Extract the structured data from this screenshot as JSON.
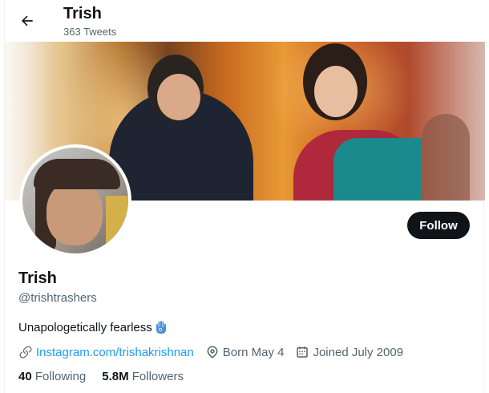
{
  "header": {
    "name": "Trish",
    "tweet_count": "363 Tweets"
  },
  "profile": {
    "name": "Trish",
    "handle": "@trishtrashers",
    "bio": "Unapologetically fearless",
    "follow_label": "Follow",
    "website": "Instagram.com/trishakrishnan",
    "born": "Born May 4",
    "joined": "Joined July 2009",
    "following_count": "40",
    "following_label": "Following",
    "followers_count": "5.8M",
    "followers_label": "Followers"
  },
  "icons": {
    "back": "back-arrow-icon",
    "link": "link-icon",
    "location": "location-icon",
    "calendar": "calendar-icon",
    "bio_emoji": "hamsa-icon"
  },
  "colors": {
    "accent": "#1d9bf0",
    "text": "#0f1419",
    "muted": "#536471",
    "follow_button": "#0f1419"
  }
}
